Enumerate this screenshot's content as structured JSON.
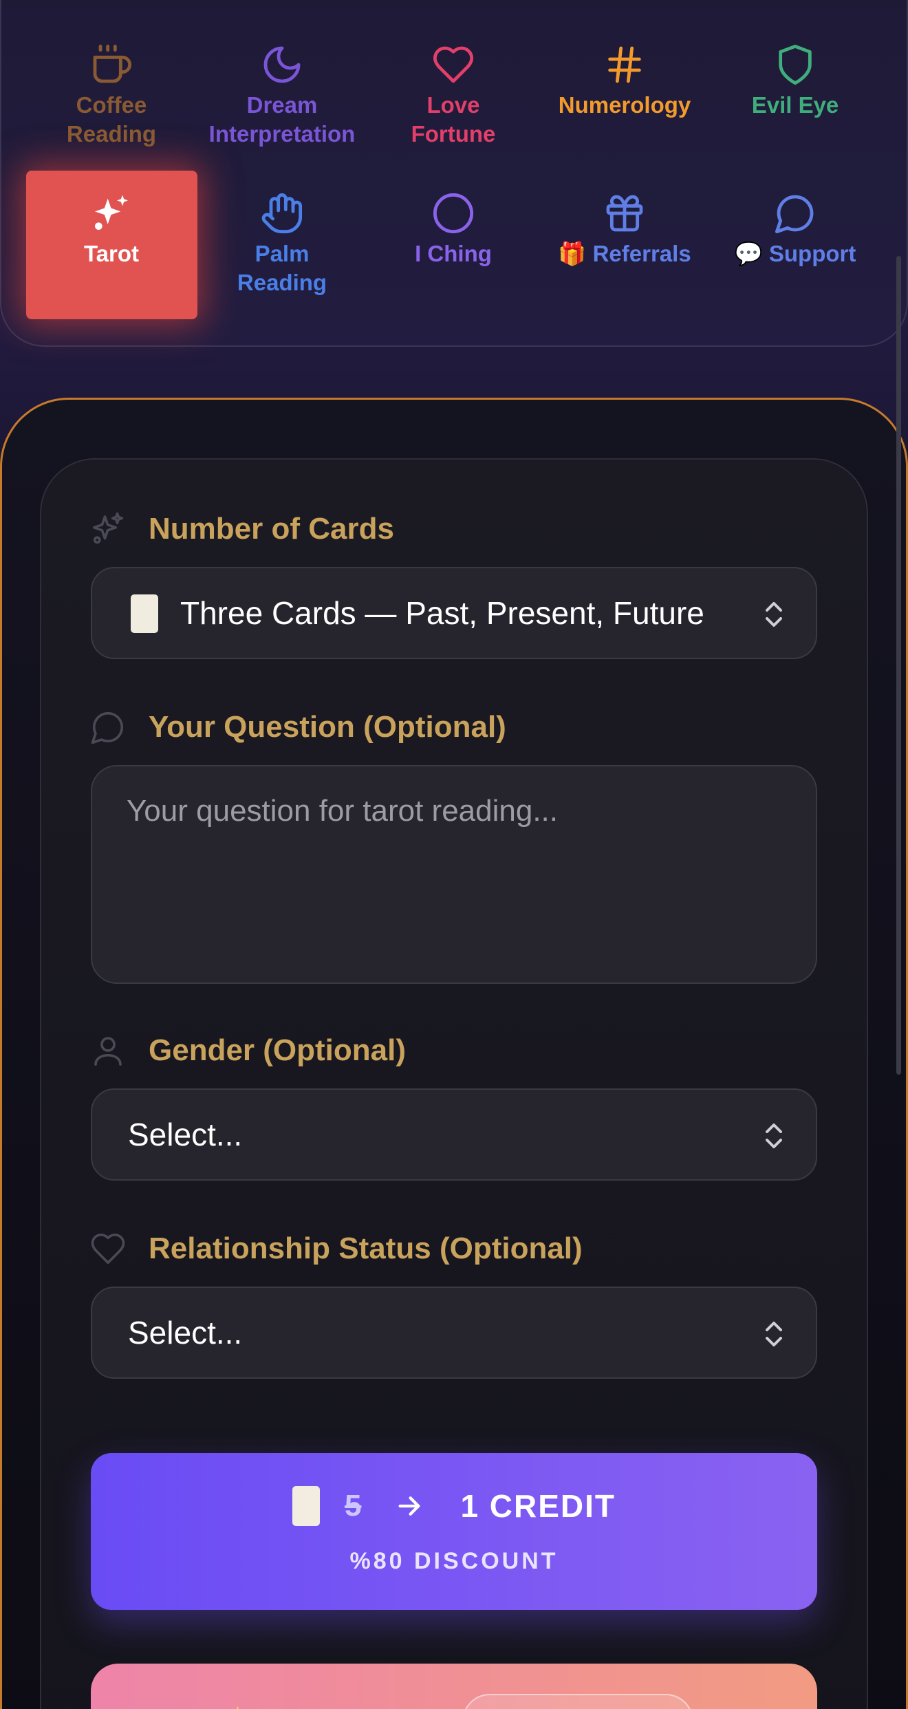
{
  "nav": {
    "items": [
      {
        "label": "Coffee Reading",
        "line1": "Coffee",
        "line2": "Reading",
        "icon": "coffee-icon",
        "color": "#8a5a33"
      },
      {
        "label": "Dream Interpretation",
        "line1": "Dream",
        "line2": "Interpretation",
        "icon": "moon-icon",
        "color": "#7a55d6"
      },
      {
        "label": "Love Fortune",
        "line1": "Love",
        "line2": "Fortune",
        "icon": "heart-icon",
        "color": "#e23f6a"
      },
      {
        "label": "Numerology",
        "line1": "Numerology",
        "line2": "",
        "icon": "hash-icon",
        "color": "#f39a2c"
      },
      {
        "label": "Evil Eye",
        "line1": "Evil Eye",
        "line2": "",
        "icon": "shield-icon",
        "color": "#3fae7c"
      },
      {
        "label": "Tarot",
        "line1": "Tarot",
        "line2": "",
        "icon": "sparkles-icon",
        "color": "#ffffff",
        "active": true
      },
      {
        "label": "Palm Reading",
        "line1": "Palm",
        "line2": "Reading",
        "icon": "hand-icon",
        "color": "#4a7fe8"
      },
      {
        "label": "I Ching",
        "line1": "I Ching",
        "line2": "",
        "icon": "circle-icon",
        "color": "#8a63ea"
      },
      {
        "label": "🎁 Referrals",
        "line1": "🎁 Referrals",
        "line2": "",
        "icon": "gift-icon",
        "color": "#5f7fe6"
      },
      {
        "label": "💬 Support",
        "line1": "💬 Support",
        "line2": "",
        "icon": "chat-bubble-icon",
        "color": "#5f7fe6"
      }
    ],
    "active_color": "#e05350"
  },
  "form": {
    "cards_label": "Number of Cards",
    "cards_value": "Three Cards — Past, Present, Future",
    "question_label": "Your Question (Optional)",
    "question_placeholder": "Your question for tarot reading...",
    "gender_label": "Gender (Optional)",
    "gender_value": "Select...",
    "relationship_label": "Relationship Status (Optional)",
    "relationship_value": "Select...",
    "label_color": "#c9a25c"
  },
  "cta": {
    "old_price": "5",
    "new_price": "1 CREDIT",
    "discount": "%80 DISCOUNT"
  }
}
